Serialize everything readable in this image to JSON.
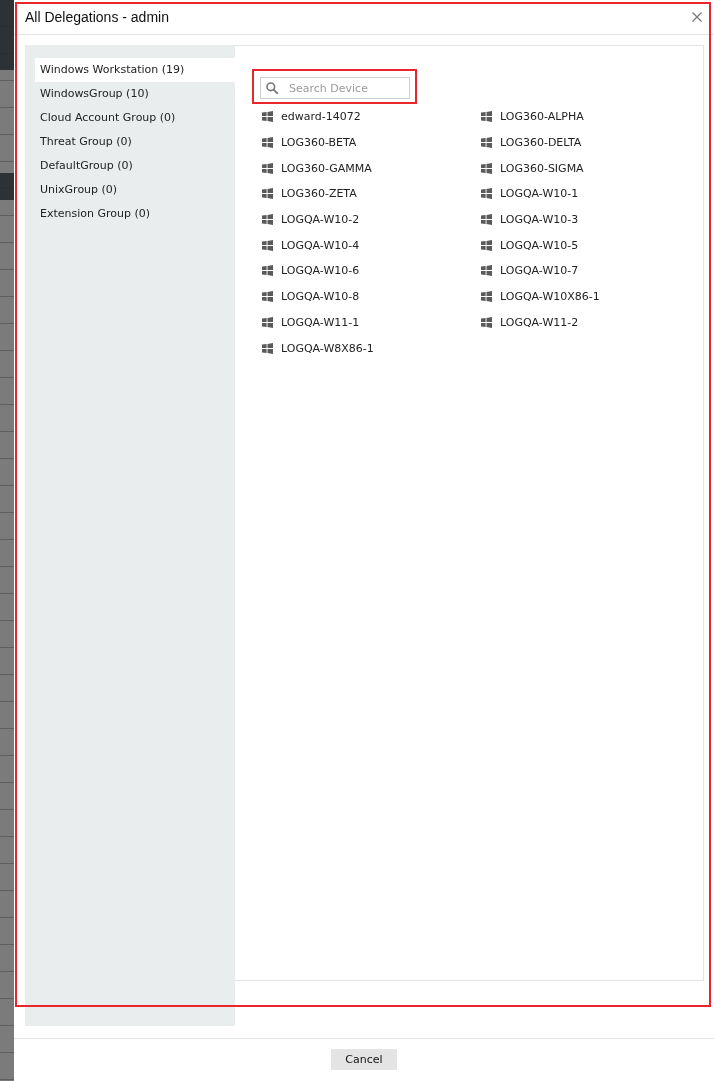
{
  "window": {
    "title": "All Delegations - admin",
    "highlighted": true
  },
  "sidebar": {
    "items": [
      {
        "label": "Windows Workstation (19)",
        "selected": true
      },
      {
        "label": "WindowsGroup (10)",
        "selected": false
      },
      {
        "label": "Cloud Account Group (0)",
        "selected": false
      },
      {
        "label": "Threat Group (0)",
        "selected": false
      },
      {
        "label": "DefaultGroup (0)",
        "selected": false
      },
      {
        "label": "UnixGroup (0)",
        "selected": false
      },
      {
        "label": "Extension Group (0)",
        "selected": false
      }
    ]
  },
  "search": {
    "placeholder": "Search Device",
    "highlighted": true
  },
  "devices": [
    "edward-14072",
    "LOG360-ALPHA",
    "LOG360-BETA",
    "LOG360-DELTA",
    "LOG360-GAMMA",
    "LOG360-SIGMA",
    "LOG360-ZETA",
    "LOGQA-W10-1",
    "LOGQA-W10-2",
    "LOGQA-W10-3",
    "LOGQA-W10-4",
    "LOGQA-W10-5",
    "LOGQA-W10-6",
    "LOGQA-W10-7",
    "LOGQA-W10-8",
    "LOGQA-W10X86-1",
    "LOGQA-W11-1",
    "LOGQA-W11-2",
    "LOGQA-W8X86-1"
  ],
  "footer": {
    "cancel_button": "Cancel"
  }
}
